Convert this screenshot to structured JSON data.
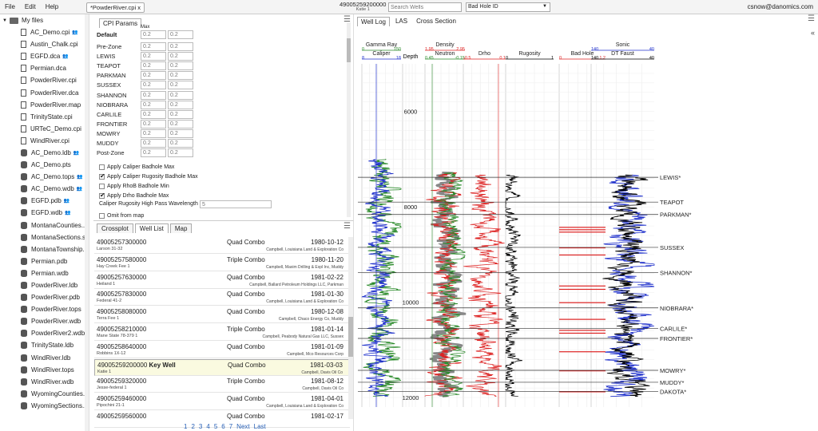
{
  "menu": [
    "File",
    "Edit",
    "Help"
  ],
  "doc_tab": "*PowderRiver.cpi x",
  "well_header": {
    "api": "49005259200000",
    "name": "Katie 1"
  },
  "search": {
    "placeholder": "Search Wells"
  },
  "select": {
    "value": "Bad Hole ID"
  },
  "user": "csnow@danomics.com",
  "tree": {
    "root": "My files",
    "items": [
      {
        "label": "AC_Demo.cpi",
        "icon": "file",
        "shared": true
      },
      {
        "label": "Austin_Chalk.cpi",
        "icon": "file",
        "shared": false
      },
      {
        "label": "EGFD.dca",
        "icon": "file",
        "shared": true
      },
      {
        "label": "Permian.dca",
        "icon": "file",
        "shared": false
      },
      {
        "label": "PowderRiver.cpi",
        "icon": "file",
        "shared": false
      },
      {
        "label": "PowderRiver.dca",
        "icon": "file",
        "shared": false
      },
      {
        "label": "PowderRiver.map",
        "icon": "file",
        "shared": false
      },
      {
        "label": "TrinityState.cpi",
        "icon": "file",
        "shared": false
      },
      {
        "label": "URTeC_Demo.cpi",
        "icon": "file",
        "shared": false
      },
      {
        "label": "WindRiver.cpi",
        "icon": "file",
        "shared": false
      },
      {
        "label": "AC_Demo.ldb",
        "icon": "db",
        "shared": true
      },
      {
        "label": "AC_Demo.pts",
        "icon": "db",
        "shared": false
      },
      {
        "label": "AC_Demo.tops",
        "icon": "db",
        "shared": true
      },
      {
        "label": "AC_Demo.wdb",
        "icon": "db",
        "shared": true
      },
      {
        "label": "EGFD.pdb",
        "icon": "db",
        "shared": true
      },
      {
        "label": "EGFD.wdb",
        "icon": "db",
        "shared": true
      },
      {
        "label": "MontanaCounties...",
        "icon": "db",
        "shared": false
      },
      {
        "label": "MontanaSections.s...",
        "icon": "db",
        "shared": false
      },
      {
        "label": "MontanaTownship...",
        "icon": "db",
        "shared": false
      },
      {
        "label": "Permian.pdb",
        "icon": "db",
        "shared": false
      },
      {
        "label": "Permian.wdb",
        "icon": "db",
        "shared": false
      },
      {
        "label": "PowderRiver.ldb",
        "icon": "db",
        "shared": false
      },
      {
        "label": "PowderRiver.pdb",
        "icon": "db",
        "shared": false
      },
      {
        "label": "PowderRiver.tops",
        "icon": "db",
        "shared": false
      },
      {
        "label": "PowderRiver.wdb",
        "icon": "db",
        "shared": false
      },
      {
        "label": "PowderRiver2.wdb",
        "icon": "db",
        "shared": false
      },
      {
        "label": "TrinityState.ldb",
        "icon": "db",
        "shared": false
      },
      {
        "label": "WindRiver.ldb",
        "icon": "db",
        "shared": false
      },
      {
        "label": "WindRiver.tops",
        "icon": "db",
        "shared": false
      },
      {
        "label": "WindRiver.wdb",
        "icon": "db",
        "shared": false
      },
      {
        "label": "WyomingCounties...",
        "icon": "db",
        "shared": false
      },
      {
        "label": "WyomingSections...",
        "icon": "db",
        "shared": false
      }
    ]
  },
  "params": {
    "tab": "CPI Params",
    "max_label": "Max",
    "rows": [
      {
        "label": "Default",
        "a": "0.2",
        "b": "0.2",
        "bold": true
      },
      {
        "label": "Pre-Zone",
        "a": "0.2",
        "b": "0.2"
      },
      {
        "label": "LEWIS",
        "a": "0.2",
        "b": "0.2"
      },
      {
        "label": "TEAPOT",
        "a": "0.2",
        "b": "0.2"
      },
      {
        "label": "PARKMAN",
        "a": "0.2",
        "b": "0.2"
      },
      {
        "label": "SUSSEX",
        "a": "0.2",
        "b": "0.2"
      },
      {
        "label": "SHANNON",
        "a": "0.2",
        "b": "0.2"
      },
      {
        "label": "NIOBRARA",
        "a": "0.2",
        "b": "0.2"
      },
      {
        "label": "CARLILE",
        "a": "0.2",
        "b": "0.2"
      },
      {
        "label": "FRONTIER",
        "a": "0.2",
        "b": "0.2"
      },
      {
        "label": "MOWRY",
        "a": "0.2",
        "b": "0.2"
      },
      {
        "label": "MUDDY",
        "a": "0.2",
        "b": "0.2"
      },
      {
        "label": "Post-Zone",
        "a": "0.2",
        "b": "0.2"
      }
    ],
    "checks": [
      {
        "label": "Apply Caliper Badhole Max",
        "on": false
      },
      {
        "label": "Apply Caliper Rugosity Badhole Max",
        "on": true
      },
      {
        "label": "Apply RhoB Badhole Min",
        "on": false
      },
      {
        "label": "Apply Drho Badhole Max",
        "on": true
      }
    ],
    "wavelength_label": "Caliper Rugosity High Pass Wavelength",
    "wavelength_value": "5",
    "omit_label": "Omit from map"
  },
  "welllist": {
    "tabs": [
      "Crossplot",
      "Well List",
      "Map"
    ],
    "rows": [
      {
        "api": "49005257300000",
        "key": "",
        "name": "Larson 31-32",
        "type": "Quad Combo",
        "date": "1980-10-12",
        "op": "Campbell, Louisiana Land & Exploration Co"
      },
      {
        "api": "49005257580000",
        "key": "",
        "name": "Hay Creek Fee 1",
        "type": "Triple Combo",
        "date": "1980-11-20",
        "op": "Campbell, Maxim Drilling & Expl Inc, Muddy"
      },
      {
        "api": "49005257630000",
        "key": "",
        "name": "Heiland 1",
        "type": "Quad Combo",
        "date": "1981-02-22",
        "op": "Campbell, Ballard Petroleum Holdings LLC, Parkman"
      },
      {
        "api": "49005257830000",
        "key": "",
        "name": "Federal 41-2",
        "type": "Quad Combo",
        "date": "1981-01-30",
        "op": "Campbell, Louisiana Land & Exploration Co"
      },
      {
        "api": "49005258080000",
        "key": "",
        "name": "Terra Fee 1",
        "type": "Quad Combo",
        "date": "1980-12-08",
        "op": "Campbell, Chaco Energy Co, Muddy"
      },
      {
        "api": "49005258210000",
        "key": "",
        "name": "Mane State 78-379 1",
        "type": "Triple Combo",
        "date": "1981-01-14",
        "op": "Campbell, Peabody Natural Gas LLC, Sussex"
      },
      {
        "api": "49005258640000",
        "key": "",
        "name": "Robbins 1X-12",
        "type": "Quad Combo",
        "date": "1981-01-09",
        "op": "Campbell, Mco Resources Corp"
      },
      {
        "api": "49005259200000",
        "key": "Key Well",
        "name": "Katie 1",
        "type": "Quad Combo",
        "date": "1981-03-03",
        "op": "Campbell, Davis Oil Co"
      },
      {
        "api": "49005259320000",
        "key": "",
        "name": "Jesse-federal 1",
        "type": "Triple Combo",
        "date": "1981-08-12",
        "op": "Campbell, Davis Oil Co"
      },
      {
        "api": "49005259460000",
        "key": "",
        "name": "Pipochini 21-1",
        "type": "Quad Combo",
        "date": "1981-04-01",
        "op": "Campbell, Louisiana Land & Exploration Co"
      },
      {
        "api": "49005259560000",
        "key": "",
        "name": "",
        "type": "Quad Combo",
        "date": "1981-02-17",
        "op": ""
      }
    ],
    "pages": [
      "1",
      "2",
      "3",
      "4",
      "5",
      "6",
      "7",
      "Next",
      "Last"
    ]
  },
  "logview": {
    "tabs": [
      "Well Log",
      "LAS",
      "Cross Section"
    ],
    "tracks": [
      {
        "title": "Gamma Ray",
        "min": "0",
        "max": "150",
        "title2": "Caliper",
        "min2": "8",
        "max2": "18",
        "color": "#2a8a2a",
        "color2": "#2233cc"
      },
      {
        "title": "Depth"
      },
      {
        "title": "Density",
        "min": "1.95",
        "max": "2.95",
        "title2": "Neutron",
        "min2": "0.45",
        "max2": "-0.15",
        "color": "#dd2222",
        "color2": "#2a8a2a"
      },
      {
        "title": "Drho",
        "min": "-0.5",
        "max": "0.1",
        "color": "#dd2222"
      },
      {
        "title": "Rugosity",
        "min": "0",
        "max": "1",
        "color": "#000000"
      },
      {
        "title": "Bad Hole",
        "min": "0",
        "max": "1.2",
        "color": "#dd2222"
      },
      {
        "title": "Sonic",
        "min": "140",
        "max": "40",
        "title2": "DT Faust",
        "min2": "140",
        "max2": "40",
        "color": "#2233cc",
        "color2": "#000000"
      }
    ],
    "depth_labels": [
      6000,
      8000,
      10000,
      12000
    ],
    "depth_range": [
      5000,
      12200
    ],
    "tops": [
      {
        "name": "LEWIS*",
        "depth": 7380
      },
      {
        "name": "TEAPOT",
        "depth": 7900
      },
      {
        "name": "PARKMAN*",
        "depth": 8160
      },
      {
        "name": "SUSSEX",
        "depth": 8850
      },
      {
        "name": "SHANNON*",
        "depth": 9380
      },
      {
        "name": "NIOBRARA*",
        "depth": 10120
      },
      {
        "name": "CARLILE*",
        "depth": 10550
      },
      {
        "name": "FRONTIER*",
        "depth": 10760
      },
      {
        "name": "MOWRY*",
        "depth": 11430
      },
      {
        "name": "MUDDY*",
        "depth": 11680
      },
      {
        "name": "DAKOTA*",
        "depth": 11870
      }
    ],
    "badhole_zones": [
      [
        8420,
        8430
      ],
      [
        8470,
        8480
      ],
      [
        8520,
        8530
      ],
      [
        8850,
        8860
      ],
      [
        9000,
        9010
      ],
      [
        9650,
        9665
      ],
      [
        9720,
        9735
      ],
      [
        10000,
        10015
      ],
      [
        10350,
        10355
      ],
      [
        10580,
        10590
      ],
      [
        10640,
        10650
      ],
      [
        11030,
        11040
      ],
      [
        11430,
        11440
      ],
      [
        11870,
        11880
      ]
    ]
  },
  "colors": {
    "accent": "#2a62b8",
    "highlight": "#fafae0"
  }
}
